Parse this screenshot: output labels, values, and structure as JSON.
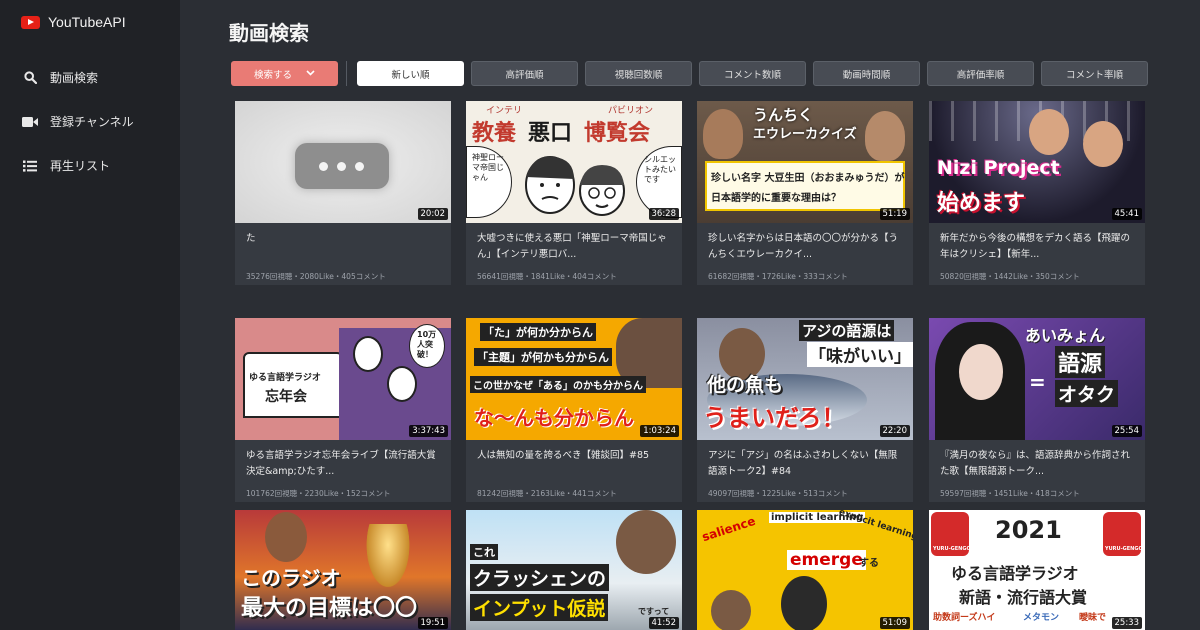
{
  "app": {
    "name": "YouTubeAPI"
  },
  "sidebar": {
    "items": [
      {
        "label": "動画検索",
        "icon": "search-icon"
      },
      {
        "label": "登録チャンネル",
        "icon": "video-camera-icon"
      },
      {
        "label": "再生リスト",
        "icon": "list-icon"
      }
    ]
  },
  "page": {
    "title": "動画検索"
  },
  "toolbar": {
    "search_label": "検索する",
    "sort_options": [
      "新しい順",
      "高評価順",
      "視聴回数順",
      "コメント数順",
      "動画時間順",
      "高評価率順",
      "コメント率順"
    ],
    "active_sort": "新しい順"
  },
  "colors": {
    "accent": "#e97b75",
    "sidebar": "#202226",
    "background": "#2b2e34",
    "card": "#363a41"
  },
  "videos": [
    {
      "title": "た",
      "meta": "35276回視聴・2080Like・405コメント",
      "duration": "20:02",
      "thumb_text": []
    },
    {
      "title": "大嘘つきに使える悪口「神聖ローマ帝国じゃん」【インテリ悪口バ...",
      "meta": "56641回視聴・1841Like・404コメント",
      "duration": "36:28",
      "thumb_text": [
        "インテリ",
        "パビリオン",
        "教養",
        "悪口",
        "博覧会",
        "神聖ローマ帝国じゃん",
        "シルエットみたいです"
      ]
    },
    {
      "title": "珍しい名字からは日本語の〇〇が分かる【うんちくエウレーカクイ...",
      "meta": "61682回視聴・1726Like・333コメント",
      "duration": "51:19",
      "thumb_text": [
        "うんちく",
        "エウレーカクイズ",
        "珍しい名字 大豆生田（おおまみゅうだ）が",
        "日本語学的に重要な理由は？"
      ]
    },
    {
      "title": "新年だから今後の構想をデカく語る【飛躍の年はクリシェ】【新年...",
      "meta": "50820回視聴・1442Like・350コメント",
      "duration": "45:41",
      "thumb_text": [
        "Nizi Project",
        "始めます"
      ]
    },
    {
      "title": "ゆる言語学ラジオ忘年会ライブ【流行語大賞決定&amp;ひたす...",
      "meta": "101762回視聴・2230Like・152コメント",
      "duration": "3:37:43",
      "thumb_text": [
        "ゆる言語学ラジオ",
        "忘年会",
        "10万人突破！"
      ]
    },
    {
      "title": "人は無知の量を誇るべき【雑談回】#85",
      "meta": "81242回視聴・2163Like・441コメント",
      "duration": "1:03:24",
      "thumb_text": [
        "「た」が何か分からん",
        "「主題」が何かも分からん",
        "この世かなぜ「ある」のかも分からん",
        "な〜んも分からん"
      ]
    },
    {
      "title": "アジに「アジ」の名はふさわしくない【無限語源トーク2】#84",
      "meta": "49097回視聴・1225Like・513コメント",
      "duration": "22:20",
      "thumb_text": [
        "アジの語源は",
        "「味がいい」",
        "他の魚も",
        "うまいだろ！"
      ]
    },
    {
      "title": "『満月の夜なら』は、語源辞典から作詞された歌【無限語源トーク...",
      "meta": "59597回視聴・1451Like・418コメント",
      "duration": "25:54",
      "thumb_text": [
        "あいみょん",
        "語源",
        "オタク",
        "="
      ]
    },
    {
      "title": "",
      "meta": "",
      "duration": "19:51",
      "thumb_text": [
        "このラジオ",
        "最大の目標は〇〇"
      ]
    },
    {
      "title": "",
      "meta": "",
      "duration": "41:52",
      "thumb_text": [
        "これ",
        "クラッシェンの",
        "インプット仮説",
        "ですって"
      ]
    },
    {
      "title": "",
      "meta": "",
      "duration": "51:09",
      "thumb_text": [
        "salience",
        "implicit learning",
        "explicit learning",
        "emerge",
        "する"
      ]
    },
    {
      "title": "",
      "meta": "",
      "duration": "25:33",
      "thumb_text": [
        "2021",
        "YURU-GENGO",
        "YURU-GENGO",
        "ゆる言語学ラジオ",
        "新語・流行語大賞",
        "助数詞ーズハイ",
        "メタモン",
        "曖昧で"
      ]
    }
  ]
}
